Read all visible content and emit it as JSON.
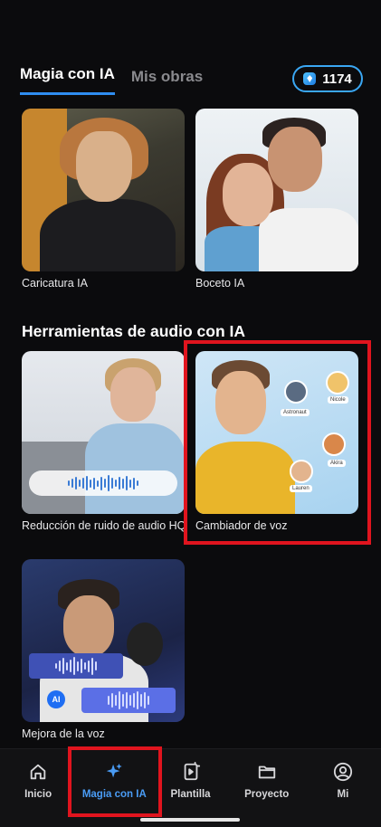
{
  "header": {
    "tabs": [
      {
        "label": "Magia con IA",
        "active": true
      },
      {
        "label": "Mis obras",
        "active": false
      }
    ],
    "credits": "1174"
  },
  "cards_top": [
    {
      "label": "Caricatura IA"
    },
    {
      "label": "Boceto IA"
    }
  ],
  "audio_section": {
    "title": "Herramientas de audio con IA",
    "cards": [
      {
        "label": "Reducción de ruido de audio HQ"
      },
      {
        "label": "Cambiador de voz",
        "avatars": [
          "Astronaut",
          "Nicole",
          "Akira",
          "Lauren"
        ]
      },
      {
        "label": "Mejora de la voz",
        "badge": "AI"
      }
    ]
  },
  "bottom_nav": [
    {
      "label": "Inicio",
      "icon": "home-icon",
      "active": false
    },
    {
      "label": "Magia con IA",
      "icon": "sparkle-icon",
      "active": true
    },
    {
      "label": "Plantilla",
      "icon": "template-icon",
      "active": false
    },
    {
      "label": "Proyecto",
      "icon": "folder-icon",
      "active": false
    },
    {
      "label": "Mi",
      "icon": "profile-icon",
      "active": false
    }
  ],
  "colors": {
    "accent": "#2f8df0",
    "highlight": "#e0141e",
    "background": "#0b0b0d"
  }
}
